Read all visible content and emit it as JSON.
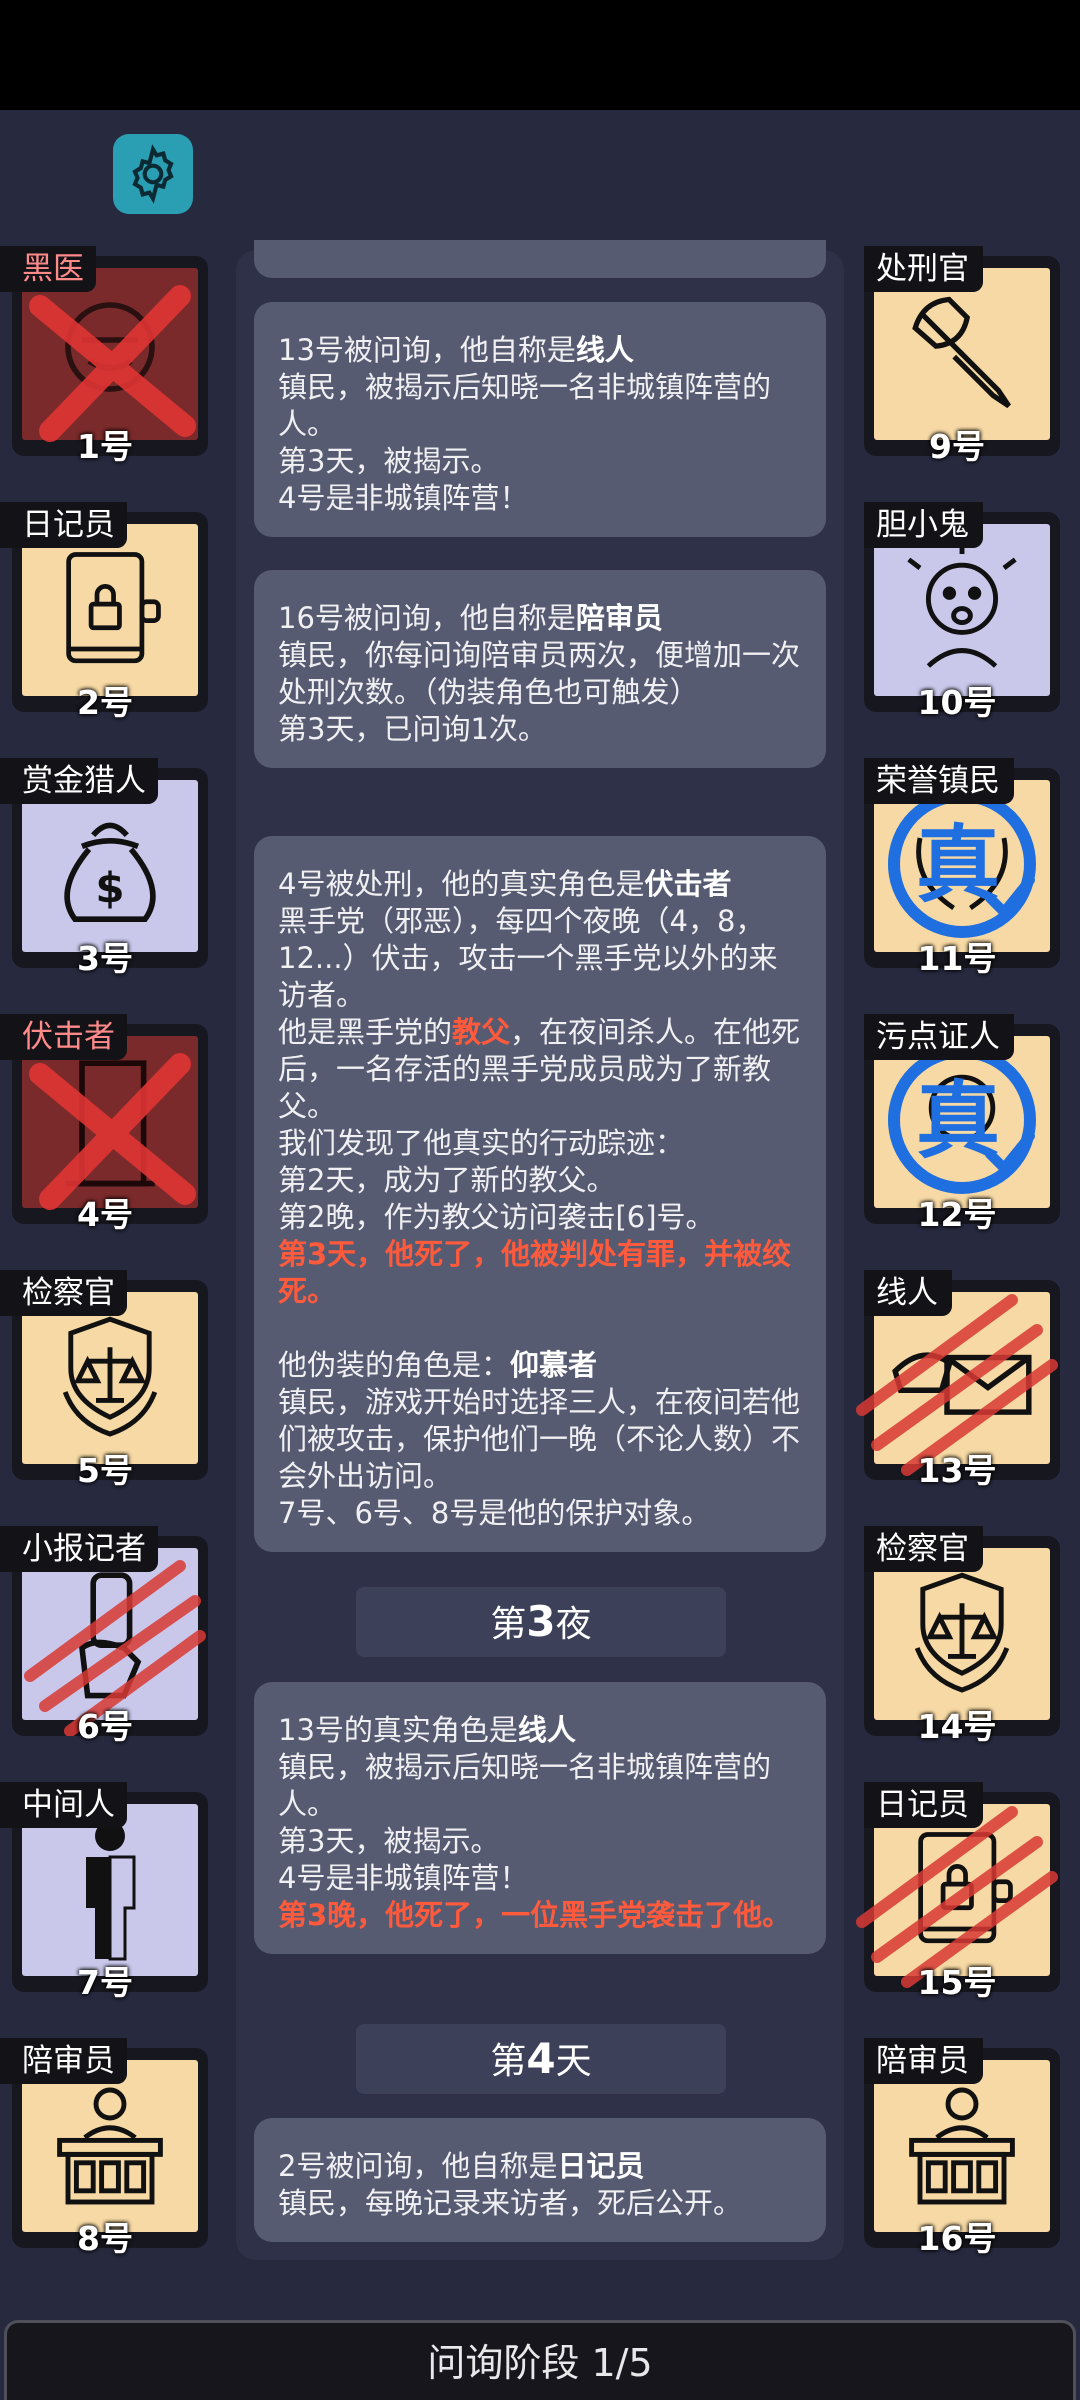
{
  "phase": "问询阶段 1/5",
  "left_cards": [
    {
      "label": "黑医",
      "number": "1号",
      "state": "dead",
      "icon": "surgeon-icon"
    },
    {
      "label": "日记员",
      "number": "2号",
      "state": "normal",
      "icon": "locked-diary-icon"
    },
    {
      "label": "赏金猎人",
      "number": "3号",
      "state": "normal",
      "icon": "money-bag-icon"
    },
    {
      "label": "伏击者",
      "number": "4号",
      "state": "dead",
      "icon": "door-icon"
    },
    {
      "label": "检察官",
      "number": "5号",
      "state": "normal",
      "icon": "scales-badge-icon"
    },
    {
      "label": "小报记者",
      "number": "6号",
      "state": "clawed",
      "icon": "scroll-hand-icon"
    },
    {
      "label": "中间人",
      "number": "7号",
      "state": "normal",
      "icon": "half-person-icon"
    },
    {
      "label": "陪审员",
      "number": "8号",
      "state": "normal",
      "icon": "juror-icon"
    }
  ],
  "right_cards": [
    {
      "label": "处刑官",
      "number": "9号",
      "state": "normal",
      "icon": "axe-icon"
    },
    {
      "label": "胆小鬼",
      "number": "10号",
      "state": "normal",
      "icon": "scared-face-icon"
    },
    {
      "label": "荣誉镇民",
      "number": "11号",
      "state": "verified",
      "stamp": "真",
      "icon": "laurel-icon"
    },
    {
      "label": "污点证人",
      "number": "12号",
      "state": "verified",
      "stamp": "真",
      "icon": "witness-icon"
    },
    {
      "label": "线人",
      "number": "13号",
      "state": "clawed",
      "icon": "envelope-hand-icon"
    },
    {
      "label": "检察官",
      "number": "14号",
      "state": "normal",
      "icon": "scales-badge-icon"
    },
    {
      "label": "日记员",
      "number": "15号",
      "state": "clawed",
      "icon": "locked-diary-icon"
    },
    {
      "label": "陪审员",
      "number": "16号",
      "state": "normal",
      "icon": "juror-icon"
    }
  ],
  "log": {
    "m1": {
      "l1a": "13号被问询，他自称是",
      "l1b": "线人",
      "l2": "镇民，被揭示后知晓一名非城镇阵营的人。",
      "l3": "第3天，被揭示。",
      "l4": "4号是非城镇阵营！"
    },
    "m2": {
      "l1a": "16号被问询，他自称是",
      "l1b": "陪审员",
      "l2": "镇民，你每问询陪审员两次，便增加一次处刑次数。（伪装角色也可触发）",
      "l3": "第3天，已问询1次。"
    },
    "m3": {
      "l1a": "4号被处刑，他的真实角色是",
      "l1b": "伏击者",
      "l2": "黑手党（邪恶），每四个夜晚（4，8，12...）伏击，攻击一个黑手党以外的来访者。",
      "l3a": "他是黑手党的",
      "l3b": "教父",
      "l3c": "，在夜间杀人。在他死后，一名存活的黑手党成员成为了新教父。",
      "l4": "我们发现了他真实的行动踪迹：",
      "l5": "第2天，成为了新的教父。",
      "l6": "第2晚，作为教父访问袭击[6]号。",
      "l7": "第3天，他死了，他被判处有罪，并被绞死。",
      "l8a": "他伪装的角色是：",
      "l8b": "仰慕者",
      "l9": "镇民，游戏开始时选择三人，在夜间若他们被攻击，保护他们一晚（不论人数）不会外出访问。",
      "l10": "7号、6号、8号是他的保护对象。"
    },
    "div1": {
      "pre": "第",
      "num": "3",
      "post": "夜"
    },
    "m4": {
      "l1a": "13号的真实角色是",
      "l1b": "线人",
      "l2": "镇民，被揭示后知晓一名非城镇阵营的人。",
      "l3": "第3天，被揭示。",
      "l4": "4号是非城镇阵营！",
      "l5": "第3晚，他死了，一位黑手党袭击了他。"
    },
    "div2": {
      "pre": "第",
      "num": "4",
      "post": "天"
    },
    "m5": {
      "l1a": "2号被问询，他自称是",
      "l1b": "日记员",
      "l2": "镇民，每晚记录来访者，死后公开。"
    }
  },
  "colors": {
    "background": "#272a3f",
    "panel": "#2e3147",
    "message": "#575b72",
    "warm_card": "#f6d9a4",
    "cool_card": "#c9c8ea",
    "dead_card": "#7a2a2a",
    "accent_red": "#ff5a3c",
    "gear": "#2a9fb3"
  }
}
